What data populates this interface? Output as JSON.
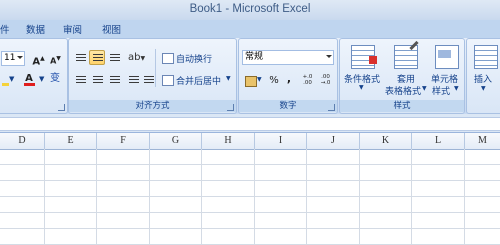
{
  "window": {
    "title": "Book1 - Microsoft Excel"
  },
  "tabs": [
    "件",
    "数据",
    "审阅",
    "视图"
  ],
  "font_group": {
    "size_value": "11",
    "grow_font": "A",
    "shrink_font": "A",
    "font_color_letter": "A",
    "wen_label": "变"
  },
  "alignment_group": {
    "label": "对齐方式",
    "wrap_text": "自动换行",
    "merge_center": "合并后居中"
  },
  "number_group": {
    "label": "数字",
    "format_value": "常规",
    "percent": "%",
    "comma": ",",
    "inc_decimal": "+.0 .00",
    "dec_decimal": ".00 →.0"
  },
  "styles_group": {
    "label": "样式",
    "conditional_format": "条件格式",
    "table_format_1": "套用",
    "table_format_2": "表格格式",
    "cell_style_1": "单元格",
    "cell_style_2": "样式"
  },
  "cells_group": {
    "insert": "插入"
  },
  "columns": [
    "D",
    "E",
    "F",
    "G",
    "H",
    "I",
    "J",
    "K",
    "L",
    "M"
  ],
  "colors": {
    "accent": "#15428b",
    "ribbon": "#d6e4f5",
    "active": "#ffd36b",
    "font_red": "#e01e1e"
  }
}
